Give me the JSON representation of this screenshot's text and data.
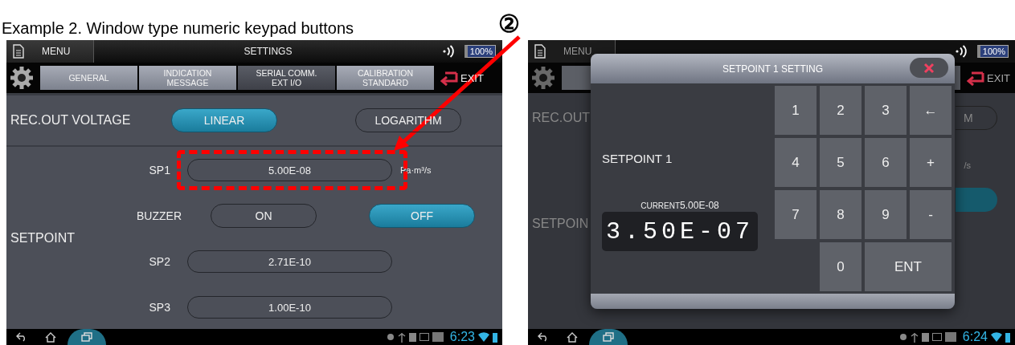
{
  "caption": "Example 2. Window type numeric keypad buttons",
  "callout": {
    "number": "②"
  },
  "settings_screen": {
    "title_bar": {
      "menu": "MENU",
      "title": "SETTINGS",
      "battery": "100%"
    },
    "tabs": [
      {
        "label": "GENERAL",
        "selected": false
      },
      {
        "label": "INDICATION\nMESSAGE",
        "selected": false
      },
      {
        "label": "SERIAL COMM.\nEXT I/O",
        "selected": true
      },
      {
        "label": "CALIBRATION\nSTANDARD",
        "selected": false
      }
    ],
    "exit": "EXIT",
    "rec_out": {
      "label": "REC.OUT VOLTAGE",
      "options": [
        {
          "label": "LINEAR",
          "selected": true
        },
        {
          "label": "LOGARITHM",
          "selected": false
        }
      ]
    },
    "setpoint": {
      "label": "SETPOINT",
      "rows": [
        {
          "kind": "value",
          "label": "SP1",
          "value": "5.00E-08",
          "unit": "Pa·m³/s",
          "highlighted": true
        },
        {
          "kind": "toggle",
          "label": "BUZZER",
          "options": [
            {
              "label": "ON",
              "selected": false
            },
            {
              "label": "OFF",
              "selected": true
            }
          ]
        },
        {
          "kind": "value",
          "label": "SP2",
          "value": "2.71E-10",
          "highlighted": false
        },
        {
          "kind": "value",
          "label": "SP3",
          "value": "1.00E-10",
          "highlighted": false
        }
      ]
    },
    "nav_bar": {
      "time": "6:23"
    }
  },
  "keypad_screen": {
    "background": {
      "menu": "MENU",
      "battery": "100%",
      "exit": "EXIT",
      "rec_out": "REC.OUT",
      "option_fragment": "M",
      "unit_fragment": "/s",
      "setpoint": "SETPOIN"
    },
    "dialog": {
      "title": "SETPOINT 1 SETTING",
      "label": "SETPOINT 1",
      "current_label": "CURRENT",
      "current_value": "5.00E-08",
      "entry": "3.50E-07",
      "keys": [
        {
          "label": "1",
          "kind": "digit"
        },
        {
          "label": "2",
          "kind": "digit"
        },
        {
          "label": "3",
          "kind": "digit"
        },
        {
          "label": "←",
          "kind": "back"
        },
        {
          "label": "4",
          "kind": "digit"
        },
        {
          "label": "5",
          "kind": "digit"
        },
        {
          "label": "6",
          "kind": "digit"
        },
        {
          "label": "+",
          "kind": "sign"
        },
        {
          "label": "7",
          "kind": "digit"
        },
        {
          "label": "8",
          "kind": "digit"
        },
        {
          "label": "9",
          "kind": "digit"
        },
        {
          "label": "-",
          "kind": "sign"
        },
        {
          "label": "0",
          "kind": "digit"
        },
        {
          "label": "ENT",
          "kind": "enter"
        }
      ]
    },
    "nav_bar": {
      "time": "6:24"
    }
  }
}
